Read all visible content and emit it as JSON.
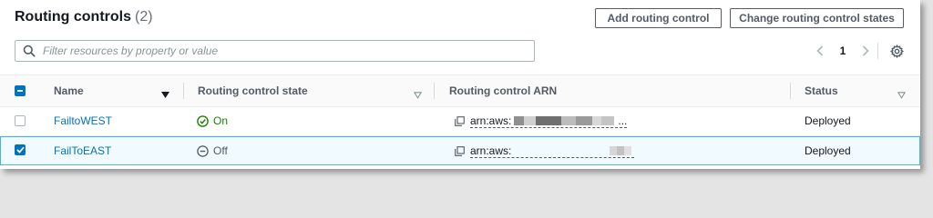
{
  "header": {
    "title": "Routing controls",
    "count": "(2)"
  },
  "actions": {
    "add_label": "Add routing control",
    "change_label": "Change routing control states"
  },
  "search": {
    "placeholder": "Filter resources by property or value",
    "value": ""
  },
  "pagination": {
    "current_page": "1"
  },
  "table": {
    "columns": {
      "name": "Name",
      "state": "Routing control state",
      "arn": "Routing control ARN",
      "status": "Status"
    },
    "rows": [
      {
        "name": "FailtoWEST",
        "state": "On",
        "state_icon": "check-circle-icon",
        "arn_prefix": "arn:aws:",
        "arn_suffix": "...",
        "status": "Deployed",
        "selected": false
      },
      {
        "name": "FailToEAST",
        "state": "Off",
        "state_icon": "minus-circle-icon",
        "arn_prefix": "arn:aws:",
        "arn_suffix": "",
        "status": "Deployed",
        "selected": true
      }
    ]
  },
  "colors": {
    "accent": "#0073bb",
    "on": "#1d8102",
    "selected_border": "#44b9d6",
    "selected_bg": "#f1faff"
  }
}
